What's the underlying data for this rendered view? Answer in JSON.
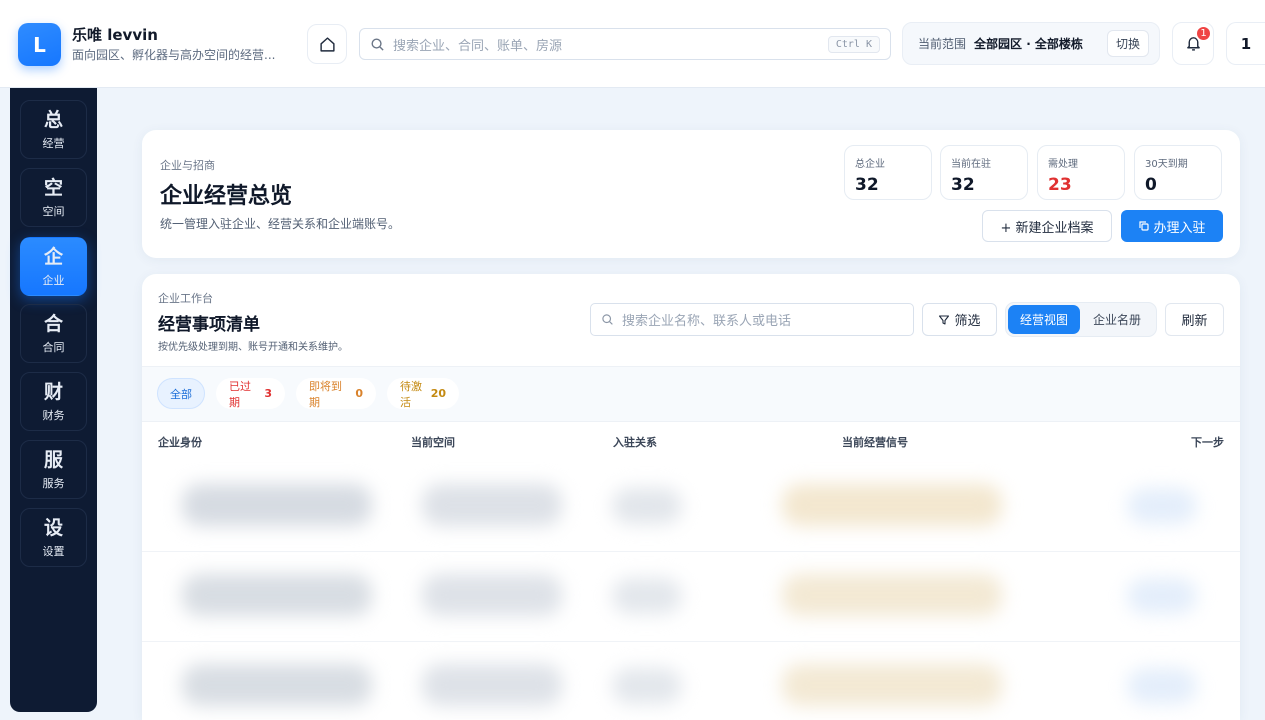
{
  "app": {
    "logo_letter": "L",
    "title": "乐唯 levvin",
    "subtitle": "面向园区、孵化器与高办空间的经营..."
  },
  "topbar": {
    "search_placeholder": "搜索企业、合同、账单、房源",
    "search_shortcut": "Ctrl K",
    "scope_label": "当前范围",
    "scope_value": "全部园区 · 全部楼栋",
    "scope_switch": "切换",
    "notification_count": "1",
    "user_initial": "1"
  },
  "sidebar": {
    "items": [
      {
        "glyph": "总",
        "label": "经营",
        "active": false
      },
      {
        "glyph": "空",
        "label": "空间",
        "active": false
      },
      {
        "glyph": "企",
        "label": "企业",
        "active": true
      },
      {
        "glyph": "合",
        "label": "合同",
        "active": false
      },
      {
        "glyph": "财",
        "label": "财务",
        "active": false
      },
      {
        "glyph": "服",
        "label": "服务",
        "active": false
      },
      {
        "glyph": "设",
        "label": "设置",
        "active": false
      }
    ]
  },
  "overview": {
    "breadcrumb": "企业与招商",
    "title": "企业经营总览",
    "description": "统一管理入驻企业、经营关系和企业端账号。",
    "stats": [
      {
        "label": "总企业",
        "value": "32"
      },
      {
        "label": "当前在驻",
        "value": "32"
      },
      {
        "label": "需处理",
        "value": "23"
      },
      {
        "label": "30天到期",
        "value": "0"
      }
    ],
    "new_button": "+ 新建企业档案",
    "primary_button": "办理入驻"
  },
  "worklist": {
    "breadcrumb": "企业工作台",
    "title": "经营事项清单",
    "description": "按优先级处理到期、账号开通和关系维护。",
    "search_placeholder": "搜索企业名称、联系人或电话",
    "filter_button": "筛选",
    "view_business": "经营视图",
    "view_directory": "企业名册",
    "refresh_button": "刷新",
    "chips": [
      {
        "label": "全部",
        "count": ""
      },
      {
        "label": "已过期",
        "count": "3"
      },
      {
        "label": "即将到期",
        "count": "0"
      },
      {
        "label": "待激活",
        "count": "20"
      }
    ],
    "columns": [
      "企业身份",
      "当前空间",
      "入驻关系",
      "当前经营信号",
      "下一步"
    ]
  },
  "colors": {
    "primary": "#1c82f5",
    "sidebar_bg": "#0e1b33",
    "danger": "#e03131",
    "warning": "#d9822b"
  }
}
